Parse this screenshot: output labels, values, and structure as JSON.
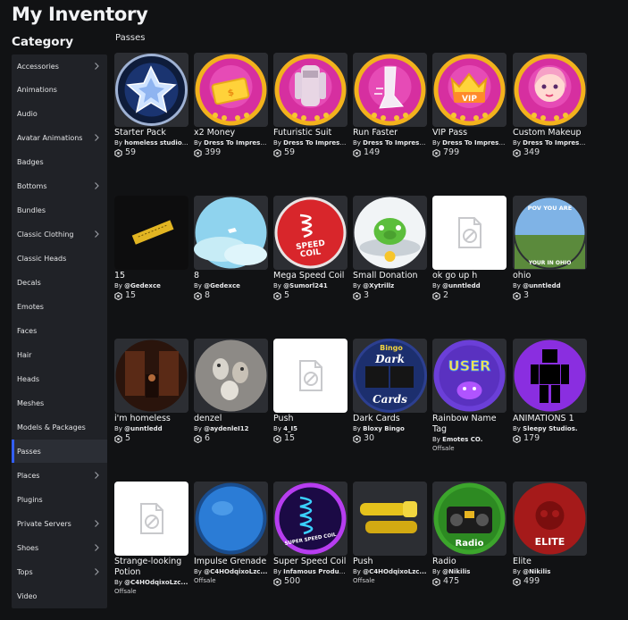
{
  "header": {
    "title": "My Inventory",
    "category_title": "Category",
    "section": "Passes"
  },
  "sidebar": {
    "items": [
      {
        "label": "Accessories",
        "chevron": true
      },
      {
        "label": "Animations",
        "chevron": false
      },
      {
        "label": "Audio",
        "chevron": false
      },
      {
        "label": "Avatar Animations",
        "chevron": true
      },
      {
        "label": "Badges",
        "chevron": false
      },
      {
        "label": "Bottoms",
        "chevron": true
      },
      {
        "label": "Bundles",
        "chevron": false
      },
      {
        "label": "Classic Clothing",
        "chevron": true
      },
      {
        "label": "Classic Heads",
        "chevron": false
      },
      {
        "label": "Decals",
        "chevron": false
      },
      {
        "label": "Emotes",
        "chevron": false
      },
      {
        "label": "Faces",
        "chevron": false
      },
      {
        "label": "Hair",
        "chevron": false
      },
      {
        "label": "Heads",
        "chevron": false
      },
      {
        "label": "Meshes",
        "chevron": false
      },
      {
        "label": "Models & Packages",
        "chevron": false
      },
      {
        "label": "Passes",
        "chevron": false,
        "active": true
      },
      {
        "label": "Places",
        "chevron": true
      },
      {
        "label": "Plugins",
        "chevron": false
      },
      {
        "label": "Private Servers",
        "chevron": true
      },
      {
        "label": "Shoes",
        "chevron": true
      },
      {
        "label": "Tops",
        "chevron": true
      },
      {
        "label": "Video",
        "chevron": false
      }
    ]
  },
  "items": [
    {
      "name": "Starter Pack",
      "creator": "homeless studio!!!",
      "price": "59",
      "thumb": "starter-pack"
    },
    {
      "name": "x2 Money",
      "creator": "Dress To Impress ...",
      "price": "399",
      "thumb": "x2-money"
    },
    {
      "name": "Futuristic Suit",
      "creator": "Dress To Impress ...",
      "price": "59",
      "thumb": "futuristic-suit"
    },
    {
      "name": "Run Faster",
      "creator": "Dress To Impress ...",
      "price": "149",
      "thumb": "run-faster"
    },
    {
      "name": "VIP Pass",
      "creator": "Dress To Impress ...",
      "price": "799",
      "thumb": "vip-pass"
    },
    {
      "name": "Custom Makeup",
      "creator": "Dress To Impress ...",
      "price": "349",
      "thumb": "custom-makeup"
    },
    {
      "name": "15",
      "creator": "@Gedexce",
      "price": "15",
      "thumb": "ticket"
    },
    {
      "name": "8",
      "creator": "@Gedexce",
      "price": "8",
      "thumb": "sky"
    },
    {
      "name": "Mega Speed Coil",
      "creator": "@Sumorl241",
      "price": "5",
      "thumb": "speed-coil"
    },
    {
      "name": "Small Donation",
      "creator": "@Xytrillz",
      "price": "3",
      "thumb": "pig"
    },
    {
      "name": "ok go up h",
      "creator": "@unntledd",
      "price": "2",
      "thumb": "placeholder"
    },
    {
      "name": "ohio",
      "creator": "@unntledd",
      "price": "3",
      "thumb": "ohio",
      "thumb_top": "POV YOU ARE",
      "thumb_bottom": "YOUR IN OHIO"
    },
    {
      "name": "i'm homeless",
      "creator": "@unntledd",
      "price": "5",
      "thumb": "dark-room"
    },
    {
      "name": "denzel",
      "creator": "@aydenleI12",
      "price": "6",
      "thumb": "cats"
    },
    {
      "name": "Push",
      "creator": "4_I5",
      "price": "15",
      "thumb": "placeholder"
    },
    {
      "name": "Dark Cards",
      "creator": "Bloxy Bingo",
      "price": "30",
      "thumb": "dark-cards",
      "thumb_a": "Bingo",
      "thumb_b": "Dark",
      "thumb_c": "Cards"
    },
    {
      "name": "Rainbow Name Tag",
      "creator": "Emotes CO.",
      "offsale": "Offsale",
      "thumb": "user-tag",
      "thumb_a": "USER"
    },
    {
      "name": "ANIMATIONS 1",
      "creator": "Sleepy Studios.",
      "price": "179",
      "thumb": "silhouette"
    },
    {
      "name": "Strange-looking Potion",
      "creator": "@C4HOdqixoLzc...",
      "offsale": "Offsale",
      "thumb": "placeholder"
    },
    {
      "name": "Impulse Grenade",
      "creator": "@C4HOdqixoLzc...",
      "offsale": "Offsale",
      "thumb": "grenade"
    },
    {
      "name": "Super Speed Coil",
      "creator": "Infamous Produc...",
      "price": "500",
      "thumb": "super-coil",
      "thumb_a": "SUPER SPEED COIL"
    },
    {
      "name": "Push",
      "creator": "@C4HOdqixoLzc...",
      "offsale": "Offsale",
      "thumb": "push-gold"
    },
    {
      "name": "Radio",
      "creator": "@Nikilis",
      "price": "475",
      "thumb": "radio",
      "thumb_a": "Radio"
    },
    {
      "name": "Elite",
      "creator": "@Nikilis",
      "price": "499",
      "thumb": "elite",
      "thumb_a": "ELITE"
    }
  ],
  "labels": {
    "by": "By "
  },
  "colors": {
    "accent": "#335fff",
    "background": "#111214",
    "sidebar": "#202227"
  }
}
